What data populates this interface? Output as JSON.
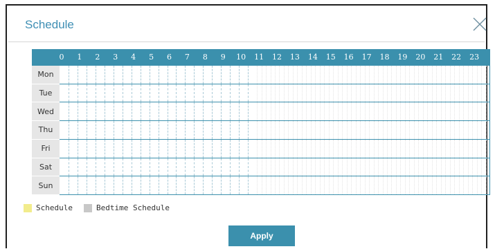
{
  "dialog": {
    "title": "Schedule",
    "close_icon": "close-icon"
  },
  "grid": {
    "hours": [
      "0",
      "1",
      "2",
      "3",
      "4",
      "5",
      "6",
      "7",
      "8",
      "9",
      "10",
      "11",
      "12",
      "13",
      "14",
      "15",
      "16",
      "17",
      "18",
      "19",
      "20",
      "21",
      "22",
      "23"
    ],
    "days": [
      "Mon",
      "Tue",
      "Wed",
      "Thu",
      "Fri",
      "Sat",
      "Sun"
    ]
  },
  "legend": {
    "schedule_label": "Schedule",
    "schedule_color": "#f2ec8c",
    "bedtime_label": "Bedtime Schedule",
    "bedtime_color": "#c8c8c8"
  },
  "actions": {
    "apply_label": "Apply"
  },
  "colors": {
    "accent": "#3b90ad",
    "title": "#3f8fb4"
  }
}
